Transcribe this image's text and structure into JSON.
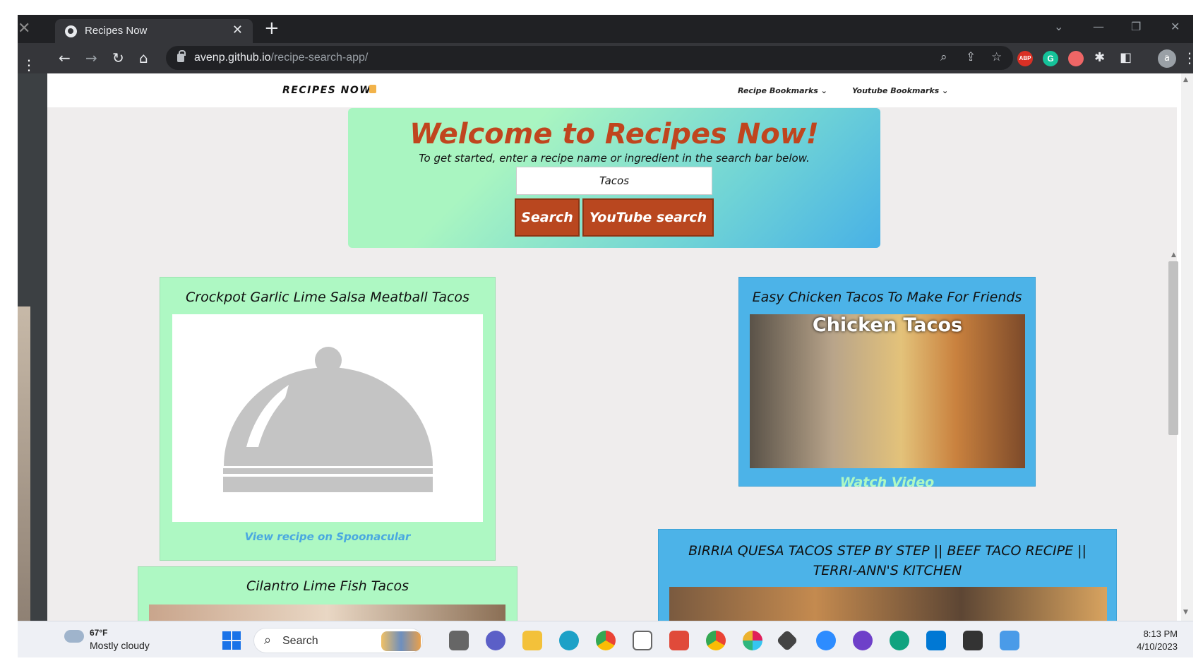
{
  "browser": {
    "tab_title": "Recipes Now",
    "url_host": "avenp.github.io",
    "url_path": "/recipe-search-app/",
    "extensions": [
      "ABP",
      "G"
    ],
    "profile_initial": "a"
  },
  "nav": {
    "brand": "RECIPES NOW",
    "dropdowns": [
      "Recipe Bookmarks",
      "Youtube Bookmarks"
    ]
  },
  "hero": {
    "title": "Welcome to Recipes Now!",
    "subtitle": "To get started, enter a recipe name or ingredient in the search bar below.",
    "search_value": "Tacos",
    "search_button": "Search",
    "youtube_button": "YouTube search"
  },
  "recipes": [
    {
      "title": "Crockpot Garlic Lime Salsa Meatball Tacos",
      "link": "View recipe on Spoonacular"
    },
    {
      "title": "Cilantro Lime Fish Tacos"
    }
  ],
  "videos": [
    {
      "title": "Easy Chicken Tacos To Make For Friends",
      "thumb_text": "Chicken Tacos",
      "link": "Watch Video"
    },
    {
      "title": "BIRRIA QUESA TACOS STEP BY STEP || BEEF TACO RECIPE || TERRI-ANN'S KITCHEN"
    }
  ],
  "colors": {
    "hero_title": "#c0451e",
    "button_bg": "#b9471f",
    "recipe_card": "#aef8c3",
    "video_card": "#4cb3e8",
    "recipe_link": "#4aa8e0",
    "video_link": "#aef8c3"
  },
  "taskbar": {
    "temperature": "67°F",
    "condition": "Mostly cloudy",
    "search_label": "Search",
    "time": "8:13 PM",
    "date": "4/10/2023"
  }
}
